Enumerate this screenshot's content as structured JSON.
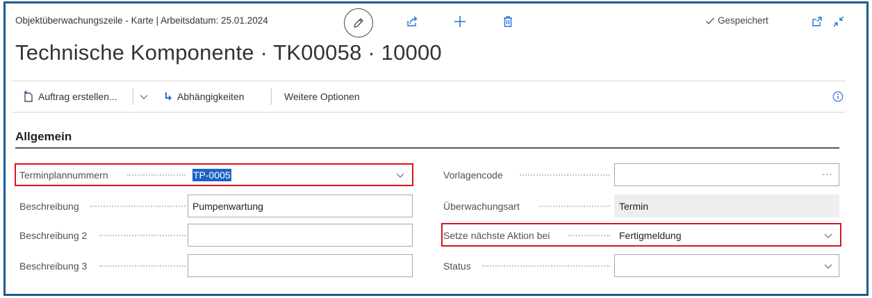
{
  "header": {
    "breadcrumb": "Objektüberwachungszeile - Karte | Arbeitsdatum: 25.01.2024",
    "title": "Technische Komponente · TK00058 · 10000",
    "saved_label": "Gespeichert",
    "icons": [
      "pencil-icon",
      "share-icon",
      "plus-icon",
      "trash-icon",
      "open-new-window-icon",
      "collapse-icon"
    ]
  },
  "actions": {
    "create_order": "Auftrag erstellen...",
    "dependencies": "Abhängigkeiten",
    "more_options": "Weitere Optionen"
  },
  "section": {
    "title": "Allgemein"
  },
  "left_fields": [
    {
      "label": "Terminplannummern",
      "value": "TP-0005",
      "type": "dropdown",
      "selected": true
    },
    {
      "label": "Beschreibung",
      "value": "Pumpenwartung",
      "type": "text"
    },
    {
      "label": "Beschreibung 2",
      "value": "",
      "type": "text"
    },
    {
      "label": "Beschreibung 3",
      "value": "",
      "type": "text"
    }
  ],
  "right_fields": [
    {
      "label": "Vorlagencode",
      "value": "",
      "type": "lookup",
      "lookup_glyph": "···"
    },
    {
      "label": "Überwachungsart",
      "value": "Termin",
      "type": "readonly"
    },
    {
      "label": "Setze nächste Aktion bei",
      "value": "Fertigmeldung",
      "type": "dropdown"
    },
    {
      "label": "Status",
      "value": "",
      "type": "dropdown"
    }
  ],
  "colors": {
    "frame": "#1f5b94",
    "highlight": "#d9141c",
    "selection": "#1d63c6"
  }
}
